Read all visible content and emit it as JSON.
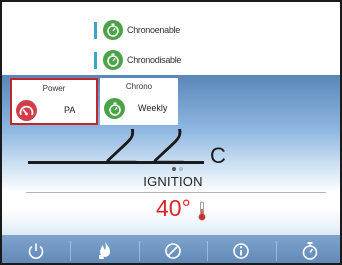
{
  "menu": {
    "items": [
      {
        "label": "Chronoenable",
        "icon": "stopwatch-icon"
      },
      {
        "label": "Chronodisable",
        "icon": "stopwatch-icon"
      }
    ]
  },
  "cards": {
    "power": {
      "title": "Power",
      "value": "PA",
      "icon": "gauge-icon",
      "color": "#d23d4a",
      "border": "#c0272d"
    },
    "chrono": {
      "title": "Chrono",
      "value": "Weekly",
      "icon": "stopwatch-icon",
      "color": "#4ba347"
    }
  },
  "main": {
    "room_temp": "22",
    "unit": "C",
    "status": "IGNITION",
    "setpoint": "40°",
    "setpoint_color": "#d9262b",
    "page_dots": {
      "count": 2,
      "active": 1
    }
  },
  "bottom_bar": {
    "buttons": [
      {
        "icon": "power-icon"
      },
      {
        "icon": "flame-hand-icon"
      },
      {
        "icon": "disable-icon"
      },
      {
        "icon": "info-icon"
      },
      {
        "icon": "stopwatch-icon"
      }
    ]
  }
}
